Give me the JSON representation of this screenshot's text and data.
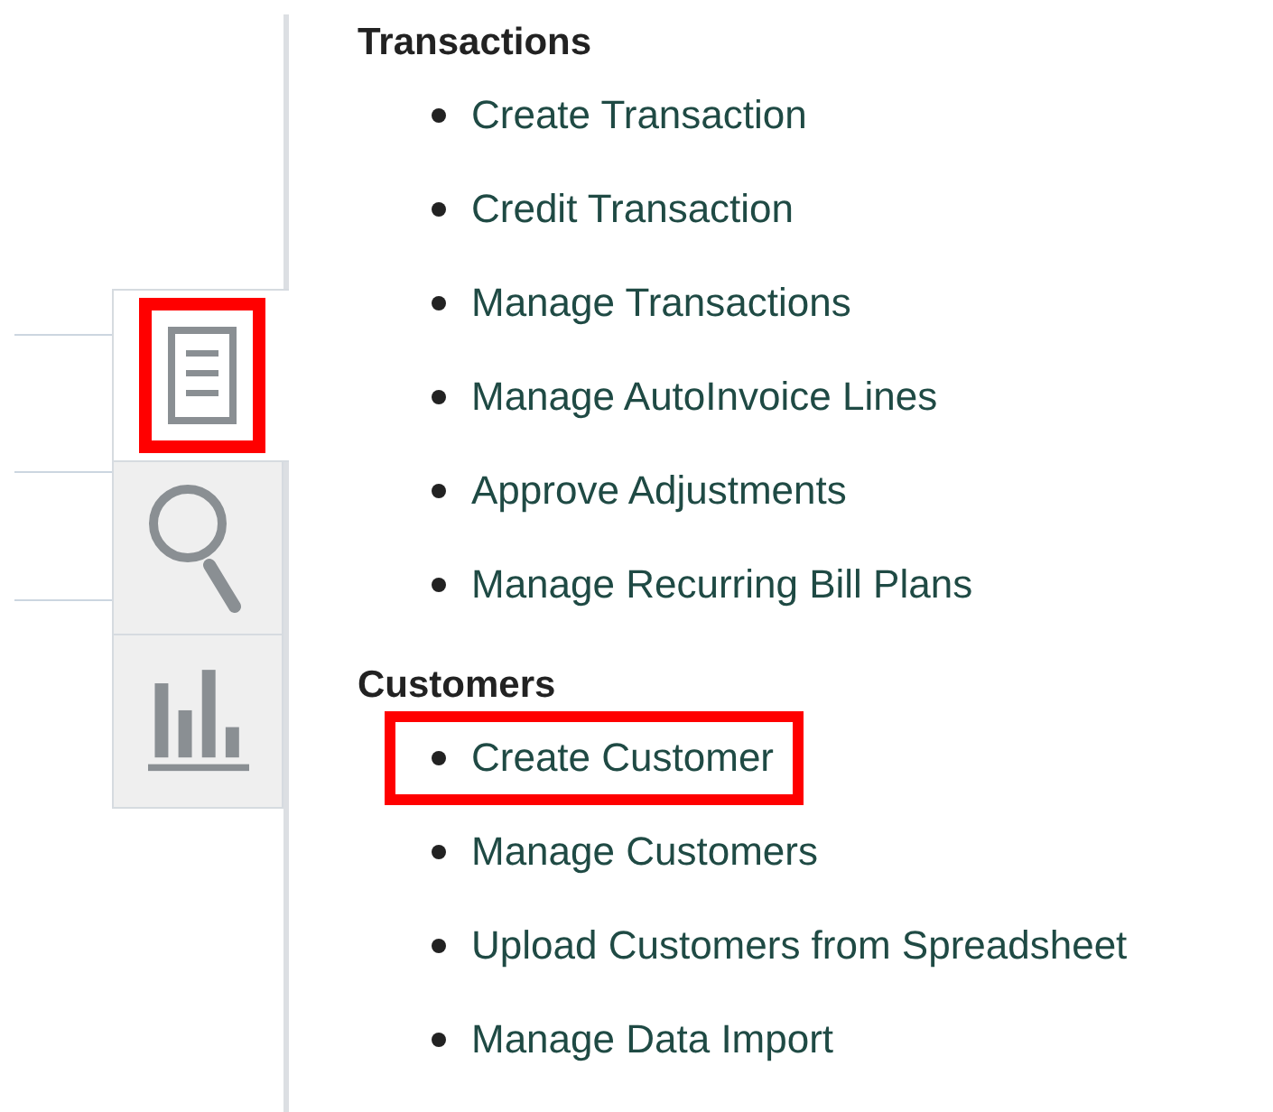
{
  "side_tabs": [
    {
      "kind": "tasks",
      "selected": true,
      "highlighted": true
    },
    {
      "kind": "search",
      "selected": false,
      "highlighted": false
    },
    {
      "kind": "reports",
      "selected": false,
      "highlighted": false
    }
  ],
  "sections": [
    {
      "heading": "Transactions",
      "items": [
        {
          "label": "Create Transaction",
          "highlighted": false
        },
        {
          "label": "Credit Transaction",
          "highlighted": false
        },
        {
          "label": "Manage Transactions",
          "highlighted": false
        },
        {
          "label": "Manage AutoInvoice Lines",
          "highlighted": false
        },
        {
          "label": "Approve Adjustments",
          "highlighted": false
        },
        {
          "label": "Manage Recurring Bill Plans",
          "highlighted": false
        }
      ]
    },
    {
      "heading": "Customers",
      "items": [
        {
          "label": "Create Customer",
          "highlighted": true
        },
        {
          "label": "Manage Customers",
          "highlighted": false
        },
        {
          "label": "Upload Customers from Spreadsheet",
          "highlighted": false
        },
        {
          "label": "Manage Data Import",
          "highlighted": false
        }
      ]
    }
  ]
}
